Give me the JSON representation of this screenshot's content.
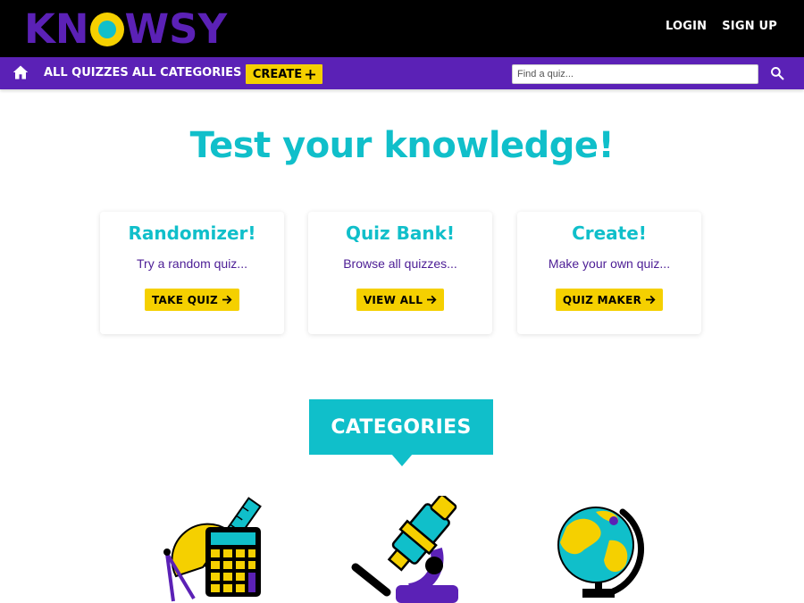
{
  "brand": {
    "logo_text_before": "KN",
    "logo_text_after": "WSY",
    "accent": "#10bfca",
    "purple": "#5b21b6",
    "yellow": "#f5d000"
  },
  "header": {
    "login_label": "LOGIN",
    "signup_label": "SIGN UP"
  },
  "nav": {
    "home_icon": "home-icon",
    "all_quizzes_label": "ALL QUIZZES",
    "all_categories_label": "ALL CATEGORIES",
    "create_label": "CREATE",
    "search_placeholder": "Find a quiz...",
    "search_icon": "search-icon"
  },
  "hero": {
    "title": "Test your knowledge!"
  },
  "cards": [
    {
      "title": "Randomizer!",
      "text": "Try a random quiz...",
      "button": "TAKE QUIZ"
    },
    {
      "title": "Quiz Bank!",
      "text": "Browse all quizzes...",
      "button": "VIEW ALL"
    },
    {
      "title": "Create!",
      "text": "Make your own quiz...",
      "button": "QUIZ MAKER"
    }
  ],
  "categories": {
    "heading": "CATEGORIES",
    "items": [
      {
        "icon": "math-tools-icon"
      },
      {
        "icon": "microscope-icon"
      },
      {
        "icon": "globe-icon"
      }
    ]
  }
}
